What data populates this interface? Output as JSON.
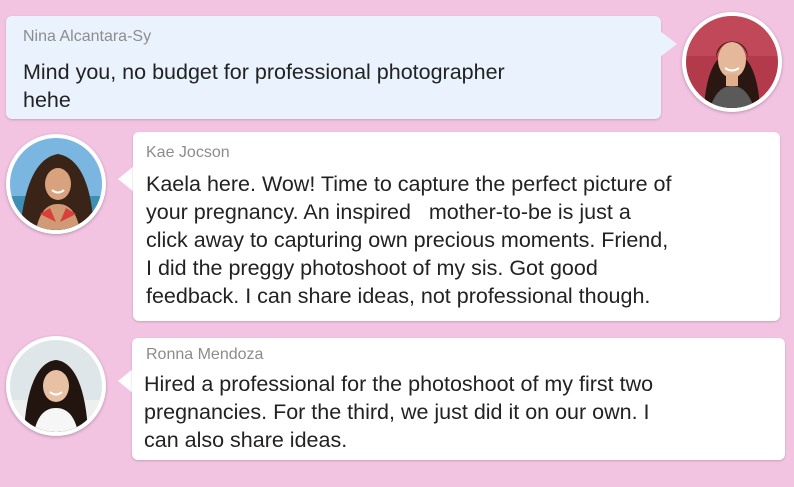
{
  "colors": {
    "background": "#f2c4e2",
    "bubble_blue": "#eaf3fd",
    "bubble_white": "#ffffff",
    "name_gray": "#8c8c8c",
    "text": "#222222"
  },
  "messages": [
    {
      "author": "Nina Alcantara-Sy",
      "lines": [
        "Mind you, no budget for professional photographer",
        "hehe"
      ],
      "style": "outgoing"
    },
    {
      "author": "Kae Jocson",
      "lines": [
        "Kaela here. Wow! Time to capture the perfect picture of",
        "your pregnancy. An inspired   mother-to-be is just a",
        "click away to capturing own precious moments. Friend,",
        "I did the preggy photoshoot of my sis. Got good",
        "feedback. I can share ideas, not professional though."
      ],
      "style": "incoming"
    },
    {
      "author": "Ronna Mendoza",
      "lines": [
        "Hired a professional for the photoshoot of my first two",
        "pregnancies. For the third, we just did it on our own. I",
        "can also share ideas."
      ],
      "style": "incoming"
    }
  ]
}
